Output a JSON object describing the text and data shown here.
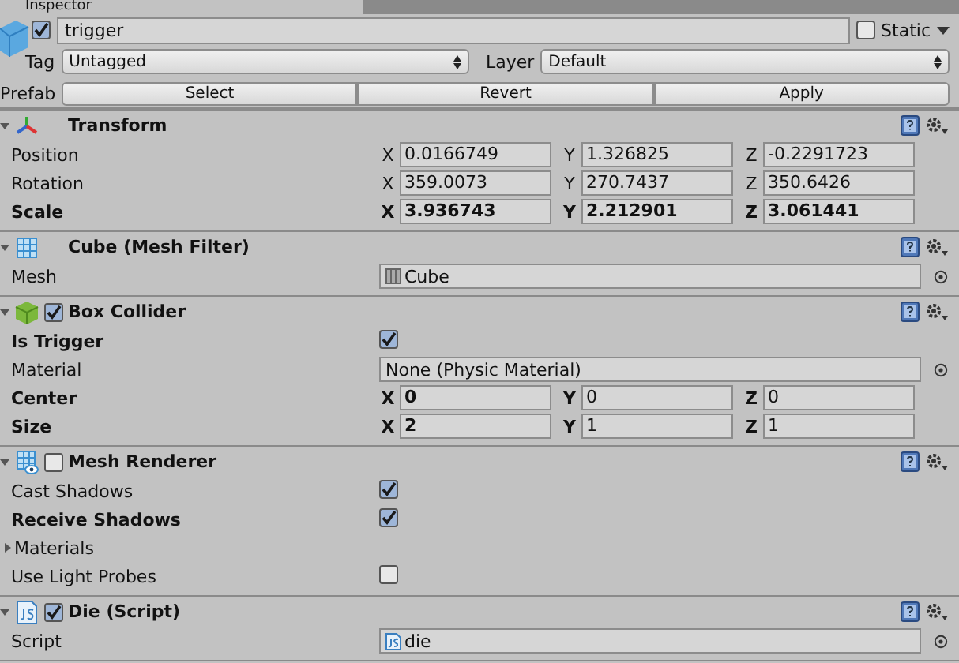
{
  "tab": {
    "title": "Inspector"
  },
  "object": {
    "active": true,
    "name": "trigger",
    "static": false,
    "static_label": "Static",
    "tag_label": "Tag",
    "tag": "Untagged",
    "layer_label": "Layer",
    "layer": "Default",
    "prefab_label": "Prefab",
    "prefab_buttons": [
      "Select",
      "Revert",
      "Apply"
    ]
  },
  "components": [
    {
      "kind": "transform",
      "title": "Transform",
      "expanded": true,
      "rows": [
        {
          "kind": "vector3",
          "label": "Position",
          "bold": false,
          "values": [
            {
              "axis": "X",
              "value": "0.0166749"
            },
            {
              "axis": "Y",
              "value": "1.326825"
            },
            {
              "axis": "Z",
              "value": "-0.2291723"
            }
          ]
        },
        {
          "kind": "vector3",
          "label": "Rotation",
          "bold": false,
          "values": [
            {
              "axis": "X",
              "value": "359.0073"
            },
            {
              "axis": "Y",
              "value": "270.7437"
            },
            {
              "axis": "Z",
              "value": "350.6426"
            }
          ]
        },
        {
          "kind": "vector3",
          "label": "Scale",
          "bold": true,
          "values": [
            {
              "axis": "X",
              "value": "3.936743"
            },
            {
              "axis": "Y",
              "value": "2.212901"
            },
            {
              "axis": "Z",
              "value": "3.061441"
            }
          ]
        }
      ]
    },
    {
      "kind": "mesh_filter",
      "title": "Cube (Mesh Filter)",
      "expanded": true,
      "rows": [
        {
          "kind": "mesh_object",
          "label": "Mesh",
          "bold": false,
          "value": "Cube"
        }
      ]
    },
    {
      "kind": "collider",
      "title": "Box Collider",
      "expanded": true,
      "enabled": true,
      "rows": [
        {
          "kind": "checkbox",
          "label": "Is Trigger",
          "bold": true,
          "checked": true
        },
        {
          "kind": "object",
          "label": "Material",
          "bold": false,
          "value": "None (Physic Material)"
        },
        {
          "kind": "vector3",
          "label": "Center",
          "bold": true,
          "values": [
            {
              "axis": "X",
              "value": "0",
              "bold": true
            },
            {
              "axis": "Y",
              "value": "0",
              "bold": false
            },
            {
              "axis": "Z",
              "value": "0",
              "bold": false
            }
          ]
        },
        {
          "kind": "vector3",
          "label": "Size",
          "bold": true,
          "values": [
            {
              "axis": "X",
              "value": "2",
              "bold": true
            },
            {
              "axis": "Y",
              "value": "1",
              "bold": false
            },
            {
              "axis": "Z",
              "value": "1",
              "bold": false
            }
          ]
        }
      ]
    },
    {
      "kind": "renderer",
      "title": "Mesh Renderer",
      "expanded": true,
      "enabled": false,
      "rows": [
        {
          "kind": "checkbox",
          "label": "Cast Shadows",
          "bold": false,
          "checked": true
        },
        {
          "kind": "checkbox",
          "label": "Receive Shadows",
          "bold": true,
          "checked": true
        },
        {
          "kind": "foldout",
          "label": "Materials",
          "bold": false,
          "expanded": false
        },
        {
          "kind": "checkbox",
          "label": "Use Light Probes",
          "bold": false,
          "checked": false
        }
      ]
    },
    {
      "kind": "script",
      "title": "Die (Script)",
      "expanded": true,
      "enabled": true,
      "rows": [
        {
          "kind": "script_object",
          "label": "Script",
          "bold": false,
          "value": "die"
        }
      ]
    }
  ]
}
